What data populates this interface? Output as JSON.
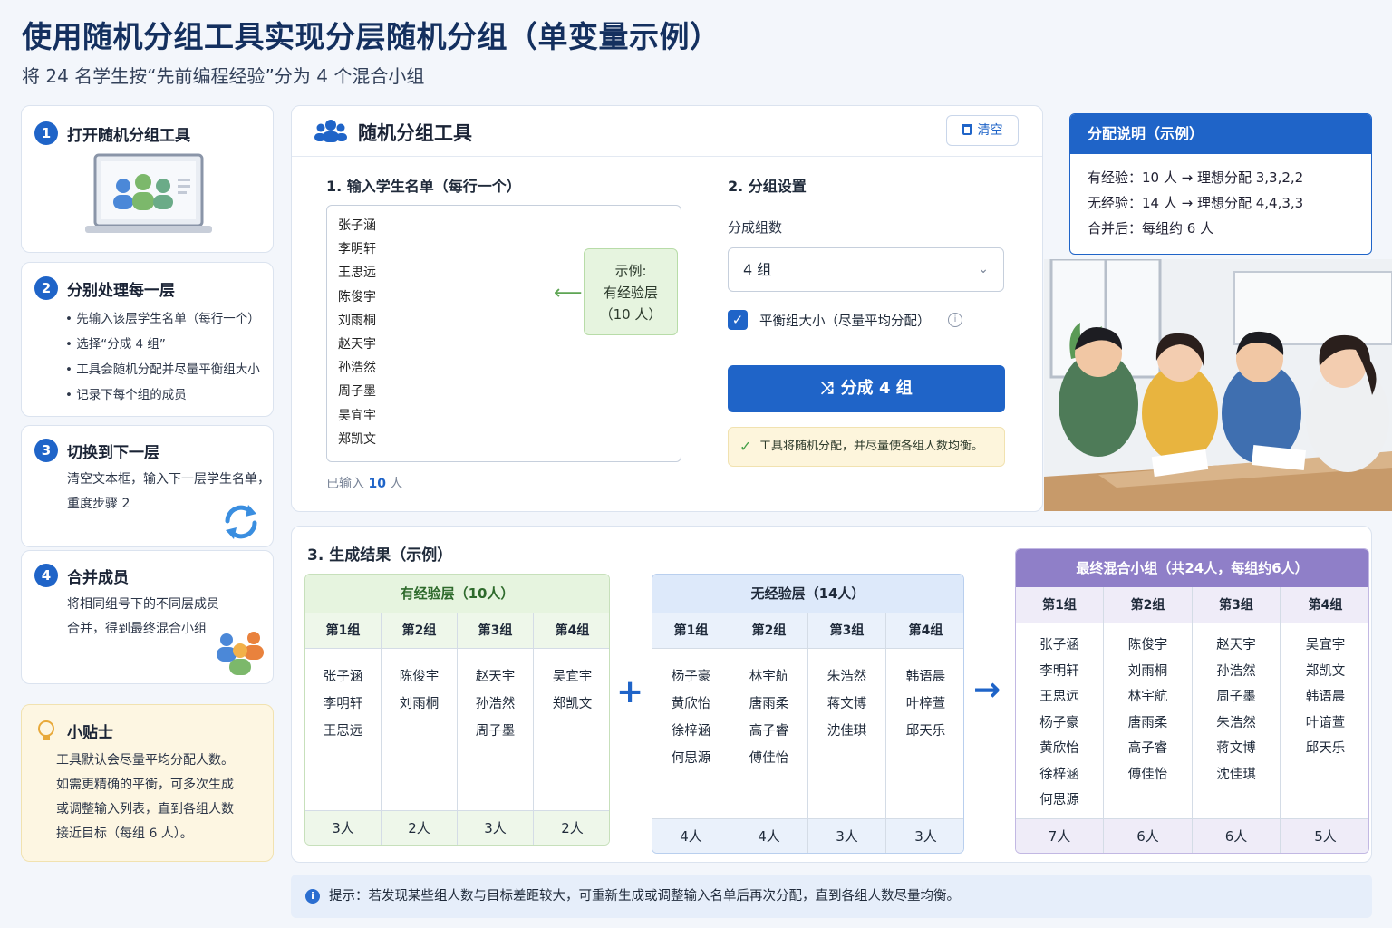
{
  "title": "使用随机分组工具实现分层随机分组（单变量示例）",
  "subtitle": "将 24 名学生按“先前编程经验”分为 4 个混合小组",
  "steps": [
    {
      "num": "1",
      "title": "打开随机分组工具"
    },
    {
      "num": "2",
      "title": "分别处理每一层",
      "bullets": [
        "先输入该层学生名单（每行一个）",
        "选择“分成 4 组”",
        "工具会随机分配并尽量平衡组大小",
        "记录下每个组的成员"
      ]
    },
    {
      "num": "3",
      "title": "切换到下一层",
      "text_lines": [
        "清空文本框，输入下一层学生名单，",
        "重度步骤 2"
      ]
    },
    {
      "num": "4",
      "title": "合并成员",
      "text_lines": [
        "将相同组号下的不同层成员",
        "合并，得到最终混合小组"
      ]
    }
  ],
  "tip": {
    "title": "小贴士",
    "lines": [
      "工具默认会尽量平均分配人数。",
      "如需更精确的平衡，可多次生成",
      "或调整输入列表，直到各组人数",
      "接近目标（每组 6 人）。"
    ]
  },
  "tool": {
    "header": "随机分组工具",
    "clear_label": "清空",
    "section1_title": "1. 输入学生名单（每行一个）",
    "names": [
      "张子涵",
      "李明轩",
      "王思远",
      "陈俊宇",
      "刘雨桐",
      "赵天宇",
      "孙浩然",
      "周子墨",
      "吴宜宇",
      "郑凯文"
    ],
    "example": {
      "line1": "示例:",
      "line2": "有经验层",
      "line3": "（10 人）"
    },
    "count_prefix": "已输入",
    "count_value": "10",
    "count_suffix": "人",
    "section2_title": "2. 分组设置",
    "group_label": "分成组数",
    "group_value": "4 组",
    "balance_label": "平衡组大小（尽量平均分配）",
    "split_label": "分成 4 组",
    "notice": "工具将随机分配，并尽量使各组人数均衡。"
  },
  "info": {
    "title": "分配说明（示例）",
    "lines": [
      "有经验：10 人 → 理想分配 3,3,2,2",
      "无经验：14 人 → 理想分配 4,4,3,3",
      "合并后：每组约 6 人"
    ]
  },
  "results": {
    "title": "3. 生成结果（示例）",
    "experienced": {
      "title": "有经验层（10人）",
      "groups": [
        {
          "name": "第1组",
          "members": [
            "张子涵",
            "李明轩",
            "王思远"
          ],
          "count": "3人"
        },
        {
          "name": "第2组",
          "members": [
            "陈俊宇",
            "刘雨桐"
          ],
          "count": "2人"
        },
        {
          "name": "第3组",
          "members": [
            "赵天宇",
            "孙浩然",
            "周子墨"
          ],
          "count": "3人"
        },
        {
          "name": "第4组",
          "members": [
            "吴宜宇",
            "郑凯文"
          ],
          "count": "2人"
        }
      ]
    },
    "novice": {
      "title": "无经验层（14人）",
      "groups": [
        {
          "name": "第1组",
          "members": [
            "杨子豪",
            "黄欣怡",
            "徐梓涵",
            "何思源"
          ],
          "count": "4人"
        },
        {
          "name": "第2组",
          "members": [
            "林宇航",
            "唐雨柔",
            "高子睿",
            "傅佳怡"
          ],
          "count": "4人"
        },
        {
          "name": "第3组",
          "members": [
            "朱浩然",
            "蒋文博",
            "沈佳琪"
          ],
          "count": "3人"
        },
        {
          "name": "第4组",
          "members": [
            "韩语晨",
            "叶梓萱",
            "邱天乐"
          ],
          "count": "3人"
        }
      ]
    },
    "final": {
      "title": "最终混合小组（共24人，每组约6人）",
      "groups": [
        {
          "name": "第1组",
          "members": [
            "张子涵",
            "李明轩",
            "王思远",
            "杨子豪",
            "黄欣怡",
            "徐梓涵",
            "何思源"
          ],
          "count": "7人"
        },
        {
          "name": "第2组",
          "members": [
            "陈俊宇",
            "刘雨桐",
            "林宇航",
            "唐雨柔",
            "高子睿",
            "傅佳怡"
          ],
          "count": "6人"
        },
        {
          "name": "第3组",
          "members": [
            "赵天宇",
            "孙浩然",
            "周子墨",
            "朱浩然",
            "蒋文博",
            "沈佳琪"
          ],
          "count": "6人"
        },
        {
          "name": "第4组",
          "members": [
            "吴宜宇",
            "郑凯文",
            "韩语晨",
            "叶谙萱",
            "邱天乐"
          ],
          "count": "5人"
        }
      ]
    },
    "plus": "+",
    "arrow": "→"
  },
  "footer_tip": "提示：若发现某些组人数与目标差距较大，可重新生成或调整输入名单后再次分配，直到各组人数尽量均衡。",
  "colors": {
    "primary": "#1f64c8",
    "experienced": "#e6f4df",
    "novice": "#dde9fa",
    "final": "#8f7fc8"
  },
  "icons": [
    "users-icon",
    "trash-icon",
    "arrow-left-icon",
    "chevron-down-icon",
    "check-icon",
    "info-icon",
    "shuffle-icon",
    "lightbulb-icon",
    "refresh-icon"
  ]
}
